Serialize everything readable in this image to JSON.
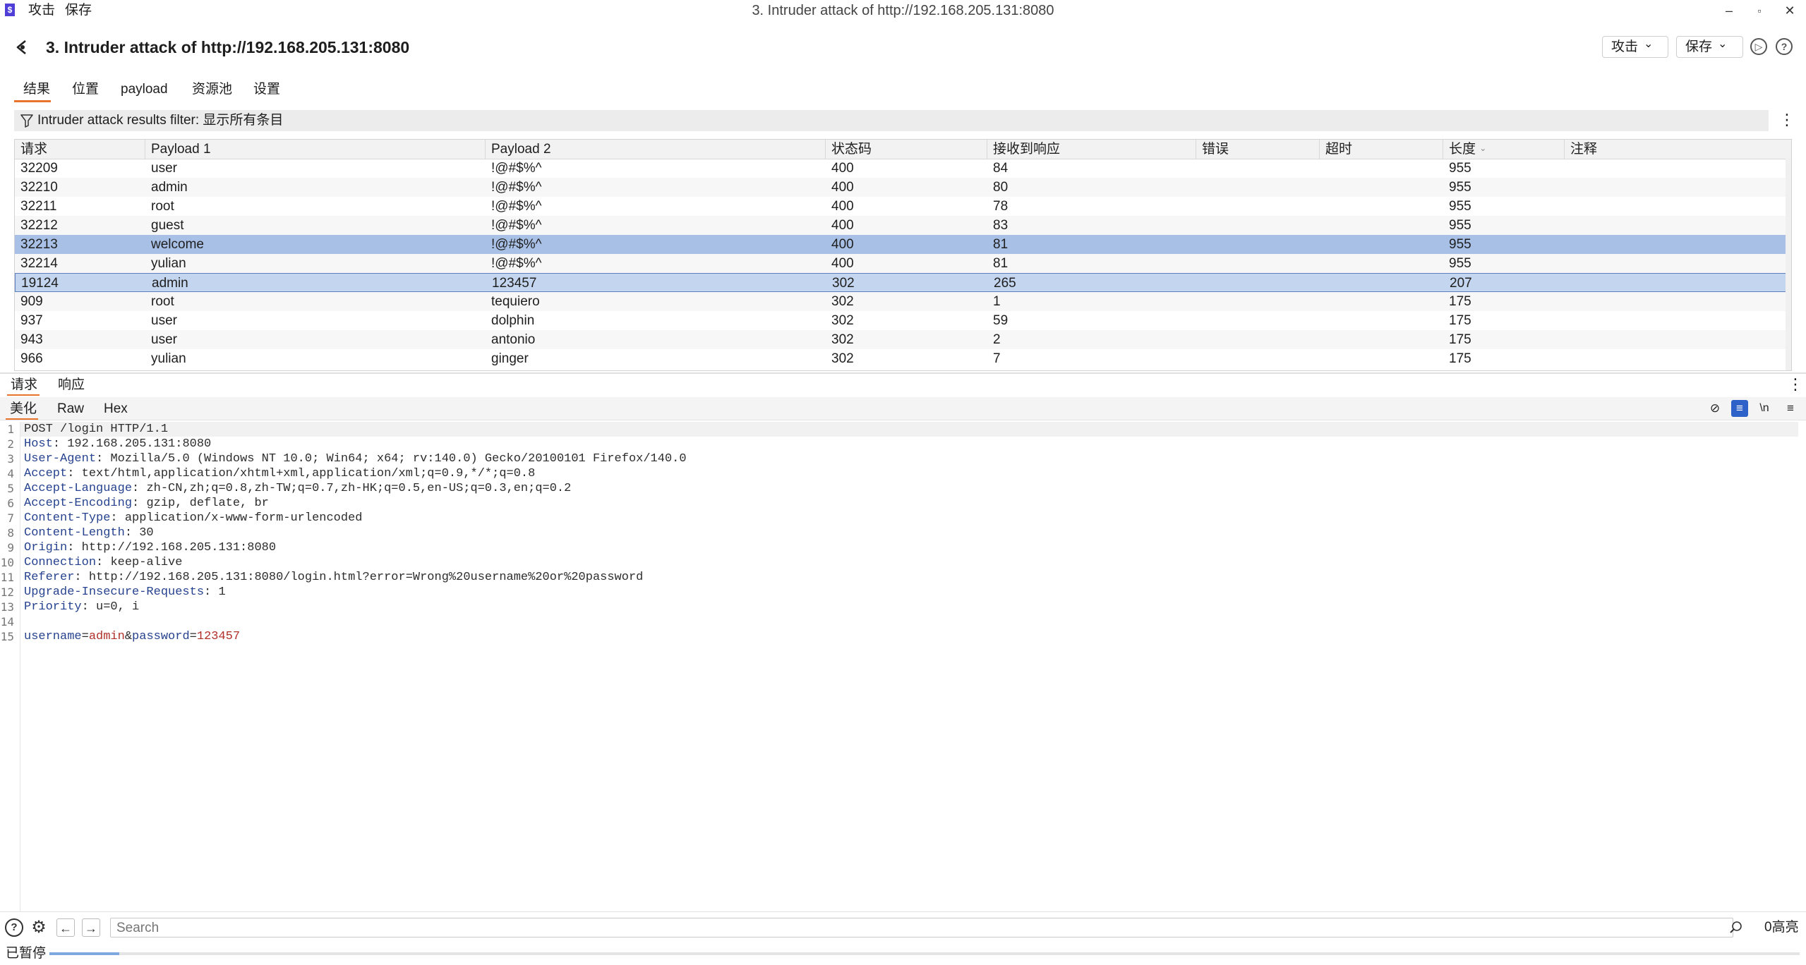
{
  "window": {
    "app_logo": "$",
    "menu": [
      "攻击",
      "保存"
    ],
    "title": "3. Intruder attack of http://192.168.205.131:8080",
    "controls": [
      "–",
      "▫",
      "✕"
    ]
  },
  "header": {
    "title": "3. Intruder attack of http://192.168.205.131:8080",
    "attack_button": "攻击",
    "save_button": "保存",
    "chevron": "⌄",
    "play_icon": "▷",
    "help_icon": "?"
  },
  "tabs": [
    "结果",
    "位置",
    "payload",
    "资源池",
    "设置"
  ],
  "filter": {
    "text": "Intruder attack results filter: 显示所有条目",
    "menu_glyph": "⋮"
  },
  "table": {
    "columns": [
      "请求",
      "Payload 1",
      "Payload 2",
      "状态码",
      "接收到响应",
      "错误",
      "超时",
      "长度",
      "注释"
    ],
    "sort_glyph": "⌄",
    "rows": [
      {
        "request": "32209",
        "p1": "user",
        "p2": "!@#$%^",
        "status": "400",
        "received": "84",
        "error": "",
        "timeout": "",
        "length": "955",
        "comment": ""
      },
      {
        "request": "32210",
        "p1": "admin",
        "p2": "!@#$%^",
        "status": "400",
        "received": "80",
        "error": "",
        "timeout": "",
        "length": "955",
        "comment": ""
      },
      {
        "request": "32211",
        "p1": "root",
        "p2": "!@#$%^",
        "status": "400",
        "received": "78",
        "error": "",
        "timeout": "",
        "length": "955",
        "comment": ""
      },
      {
        "request": "32212",
        "p1": "guest",
        "p2": "!@#$%^",
        "status": "400",
        "received": "83",
        "error": "",
        "timeout": "",
        "length": "955",
        "comment": ""
      },
      {
        "request": "32213",
        "p1": "welcome",
        "p2": "!@#$%^",
        "status": "400",
        "received": "81",
        "error": "",
        "timeout": "",
        "length": "955",
        "comment": ""
      },
      {
        "request": "32214",
        "p1": "yulian",
        "p2": "!@#$%^",
        "status": "400",
        "received": "81",
        "error": "",
        "timeout": "",
        "length": "955",
        "comment": ""
      },
      {
        "request": "19124",
        "p1": "admin",
        "p2": "123457",
        "status": "302",
        "received": "265",
        "error": "",
        "timeout": "",
        "length": "207",
        "comment": ""
      },
      {
        "request": "909",
        "p1": "root",
        "p2": "tequiero",
        "status": "302",
        "received": "1",
        "error": "",
        "timeout": "",
        "length": "175",
        "comment": ""
      },
      {
        "request": "937",
        "p1": "user",
        "p2": "dolphin",
        "status": "302",
        "received": "59",
        "error": "",
        "timeout": "",
        "length": "175",
        "comment": ""
      },
      {
        "request": "943",
        "p1": "user",
        "p2": "antonio",
        "status": "302",
        "received": "2",
        "error": "",
        "timeout": "",
        "length": "175",
        "comment": ""
      },
      {
        "request": "966",
        "p1": "yulian",
        "p2": "ginger",
        "status": "302",
        "received": "7",
        "error": "",
        "timeout": "",
        "length": "175",
        "comment": ""
      }
    ]
  },
  "pane": {
    "tabs": [
      "请求",
      "响应"
    ],
    "view_tabs": [
      "美化",
      "Raw",
      "Hex"
    ],
    "menu_glyph": "⋮",
    "tools": {
      "hide": "⊘",
      "wrap": "≡",
      "newline": "\\n",
      "menu": "≡"
    }
  },
  "request_lines": [
    {
      "num": "1",
      "key": "",
      "sep": "",
      "value": "POST /login HTTP/1.1"
    },
    {
      "num": "2",
      "key": "Host",
      "sep": ": ",
      "value": "192.168.205.131:8080"
    },
    {
      "num": "3",
      "key": "User-Agent",
      "sep": ": ",
      "value": "Mozilla/5.0 (Windows NT 10.0; Win64; x64; rv:140.0) Gecko/20100101 Firefox/140.0"
    },
    {
      "num": "4",
      "key": "Accept",
      "sep": ": ",
      "value": "text/html,application/xhtml+xml,application/xml;q=0.9,*/*;q=0.8"
    },
    {
      "num": "5",
      "key": "Accept-Language",
      "sep": ": ",
      "value": "zh-CN,zh;q=0.8,zh-TW;q=0.7,zh-HK;q=0.5,en-US;q=0.3,en;q=0.2"
    },
    {
      "num": "6",
      "key": "Accept-Encoding",
      "sep": ": ",
      "value": "gzip, deflate, br"
    },
    {
      "num": "7",
      "key": "Content-Type",
      "sep": ": ",
      "value": "application/x-www-form-urlencoded"
    },
    {
      "num": "8",
      "key": "Content-Length",
      "sep": ": ",
      "value": "30"
    },
    {
      "num": "9",
      "key": "Origin",
      "sep": ": ",
      "value": "http://192.168.205.131:8080"
    },
    {
      "num": "10",
      "key": "Connection",
      "sep": ": ",
      "value": "keep-alive"
    },
    {
      "num": "11",
      "key": "Referer",
      "sep": ": ",
      "value": "http://192.168.205.131:8080/login.html?error=Wrong%20username%20or%20password"
    },
    {
      "num": "12",
      "key": "Upgrade-Insecure-Requests",
      "sep": ": ",
      "value": "1"
    },
    {
      "num": "13",
      "key": "Priority",
      "sep": ": ",
      "value": "u=0, i"
    },
    {
      "num": "14",
      "key": "",
      "sep": "",
      "value": ""
    }
  ],
  "request_body": {
    "num": "15",
    "k1": "username",
    "eq1": "=",
    "v1": "admin",
    "amp": "&",
    "k2": "password",
    "eq2": "=",
    "v2": "123457"
  },
  "bottom": {
    "search_placeholder": "Search",
    "highlight_count": "0高亮",
    "help_icon": "?",
    "settings_icon": "⚙",
    "back_icon": "←",
    "forward_icon": "→"
  },
  "status": {
    "text": "已暂停",
    "progress": 0.04
  },
  "colors": {
    "accent": "#e8742c",
    "selected_row": "#a8c0e6",
    "selected_row_secondary": "#c4d6ef",
    "header_key": "#27438f",
    "param_value": "#b0302a"
  }
}
